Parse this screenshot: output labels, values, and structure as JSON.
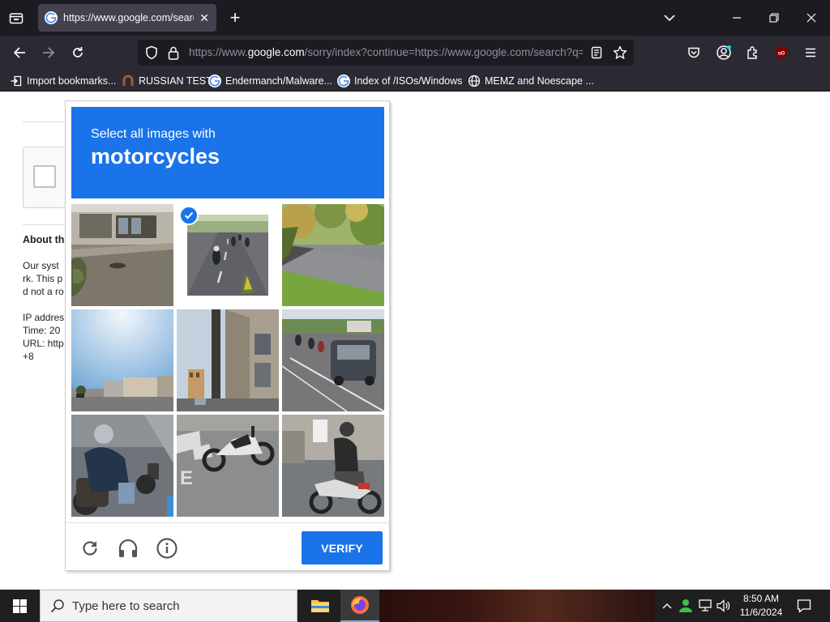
{
  "browser": {
    "tab": {
      "title": "https://www.google.com/search?q=",
      "close_glyph": "✕"
    },
    "new_tab_glyph": "+",
    "url": {
      "domain_prefix": "https://www.",
      "domain": "google.com",
      "path": "/sorry/index?continue=https://www.google.com/search?q="
    },
    "bookmarks": [
      {
        "label": "Import bookmarks...",
        "icon": "import-icon"
      },
      {
        "label": "RUSSIAN TEST",
        "icon": "favicon"
      },
      {
        "label": "Endermanch/Malware...",
        "icon": "google-favicon"
      },
      {
        "label": "Index of /ISOs/Windows",
        "icon": "google-favicon"
      },
      {
        "label": "MEMZ and Noescape ...",
        "icon": "globe-icon"
      }
    ]
  },
  "page_behind": {
    "heading": "About thi",
    "lines": [
      "Our syst",
      "rk. This p",
      "d not a ro"
    ],
    "meta": [
      "IP addres",
      "Time: 20",
      "URL: http",
      "+8"
    ]
  },
  "captcha": {
    "instruction": "Select all images with",
    "target": "motorcycles",
    "tiles": [
      {
        "desc": "street-storefront",
        "selected": false
      },
      {
        "desc": "motorcyclists-on-road",
        "selected": true
      },
      {
        "desc": "roadside-grass",
        "selected": false
      },
      {
        "desc": "sky-buildings",
        "selected": false
      },
      {
        "desc": "building-corner",
        "selected": false
      },
      {
        "desc": "van-with-motorcycles",
        "selected": false
      },
      {
        "desc": "rider-on-motorcycle",
        "selected": false
      },
      {
        "desc": "parked-dirt-bike",
        "selected": false
      },
      {
        "desc": "scooter-rider",
        "selected": false
      }
    ],
    "verify_label": "VERIFY",
    "colors": {
      "accent": "#1a73e8"
    }
  },
  "taskbar": {
    "search_placeholder": "Type here to search",
    "time": "8:50 AM",
    "date": "11/6/2024"
  }
}
